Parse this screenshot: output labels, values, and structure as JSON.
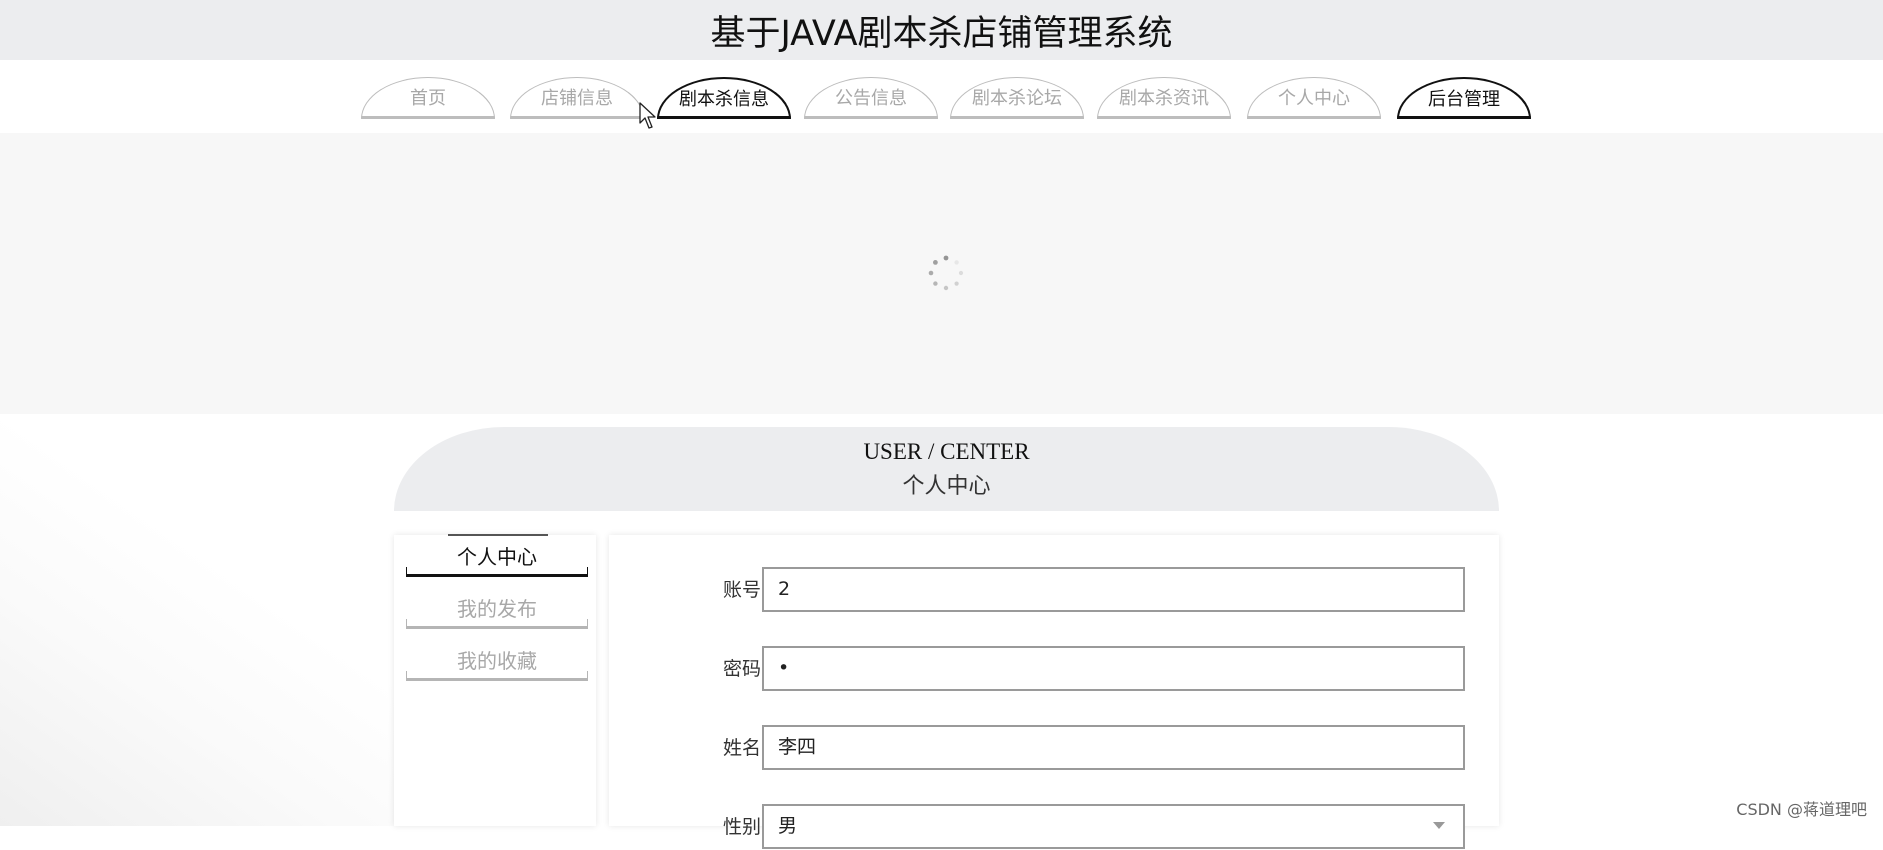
{
  "header": {
    "title": "基于JAVA剧本杀店铺管理系统"
  },
  "nav": {
    "tabs": [
      {
        "label": "首页",
        "active": false
      },
      {
        "label": "店铺信息",
        "active": false
      },
      {
        "label": "剧本杀信息",
        "active": true
      },
      {
        "label": "公告信息",
        "active": false
      },
      {
        "label": "剧本杀论坛",
        "active": false
      },
      {
        "label": "剧本杀资讯",
        "active": false
      },
      {
        "label": "个人中心",
        "active": false
      },
      {
        "label": "后台管理",
        "active": true
      }
    ]
  },
  "banner": {
    "state": "loading",
    "icon": "spinner-icon"
  },
  "section": {
    "title_en": "USER / CENTER",
    "title_cn": "个人中心"
  },
  "sidebar": {
    "items": [
      {
        "label": "个人中心",
        "active": true
      },
      {
        "label": "我的发布",
        "active": false
      },
      {
        "label": "我的收藏",
        "active": false
      }
    ]
  },
  "form": {
    "fields": [
      {
        "label": "账号",
        "value": "2"
      },
      {
        "label": "密码",
        "value": "•"
      },
      {
        "label": "姓名",
        "value": "李四"
      },
      {
        "label": "性别",
        "value": "男"
      }
    ]
  },
  "watermark": "CSDN @蒋道理吧",
  "colors": {
    "header_bg": "#ecedef",
    "active": "#111111",
    "inactive": "#a8a8a8",
    "banner_bg": "#f7f7f7"
  }
}
